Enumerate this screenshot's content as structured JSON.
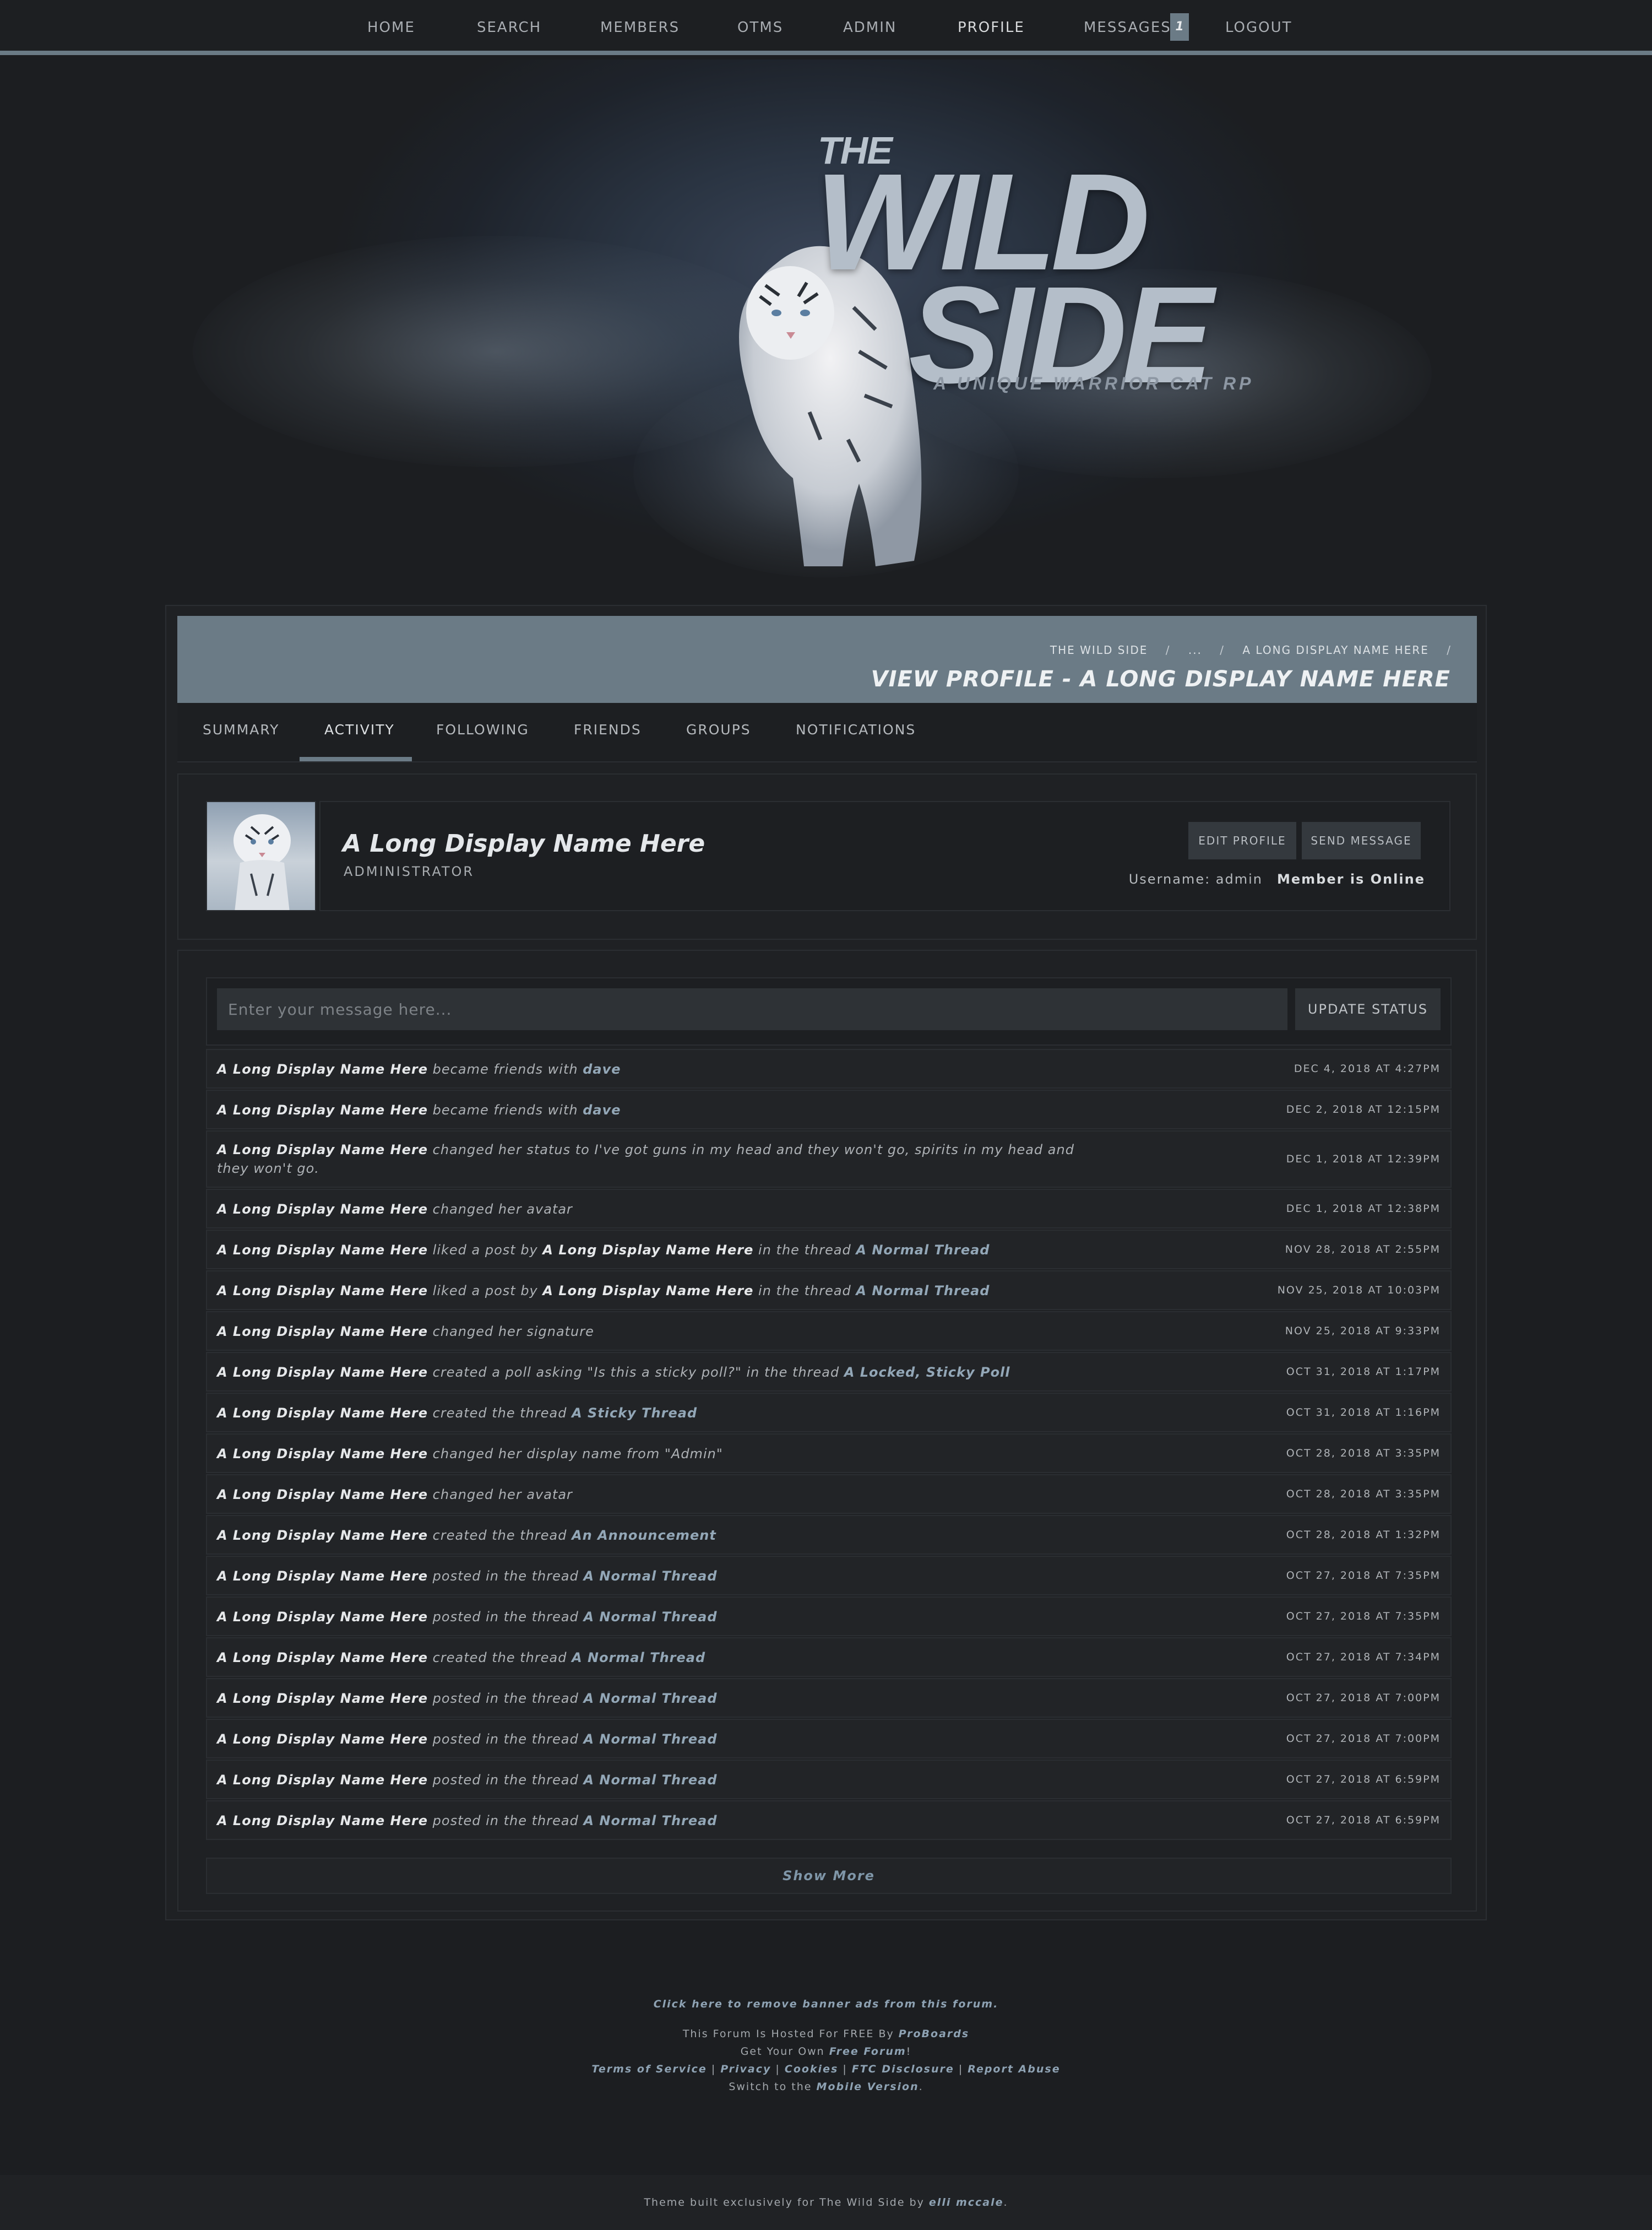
{
  "nav": {
    "items": [
      "HOME",
      "SEARCH",
      "MEMBERS",
      "OTMS",
      "ADMIN",
      "PROFILE",
      "MESSAGES",
      "LOGOUT"
    ],
    "messages_count": "1",
    "active": "PROFILE"
  },
  "banner": {
    "the": "THE",
    "wild": "WILD",
    "side": "SIDE",
    "tagline": "A UNIQUE WARRIOR CAT RP"
  },
  "breadcrumb": [
    "THE WILD SIDE",
    "/",
    "...",
    "/",
    "A LONG DISPLAY NAME HERE",
    "/"
  ],
  "page_title": "VIEW PROFILE - A LONG DISPLAY NAME HERE",
  "tabs": [
    "SUMMARY",
    "ACTIVITY",
    "FOLLOWING",
    "FRIENDS",
    "GROUPS",
    "NOTIFICATIONS"
  ],
  "active_tab": "ACTIVITY",
  "profile": {
    "display_name": "A Long Display Name Here",
    "role": "ADMINISTRATOR",
    "edit_button": "EDIT PROFILE",
    "message_button": "SEND MESSAGE",
    "username": "Username: admin",
    "online": "Member is Online"
  },
  "status": {
    "placeholder": "Enter your message here...",
    "button": "UPDATE STATUS"
  },
  "feed": [
    {
      "actor": "A Long Display Name Here",
      "action": " became friends with ",
      "target": "dave",
      "date": "DEC 4, 2018 AT 4:27PM"
    },
    {
      "actor": "A Long Display Name Here",
      "action": " became friends with ",
      "target": "dave",
      "date": "DEC 2, 2018 AT 12:15PM"
    },
    {
      "actor": "A Long Display Name Here",
      "action": " changed her status to I've got guns in my head and they won't go, spirits in my head and they won't go.",
      "target": "",
      "date": "DEC 1, 2018 AT 12:39PM"
    },
    {
      "actor": "A Long Display Name Here",
      "action": " changed her avatar",
      "target": "",
      "date": "DEC 1, 2018 AT 12:38PM"
    },
    {
      "actor": "A Long Display Name Here",
      "action": " liked a post by ",
      "actor2": "A Long Display Name Here",
      "action2": " in the thread ",
      "target": "A Normal Thread",
      "date": "NOV 28, 2018 AT 2:55PM"
    },
    {
      "actor": "A Long Display Name Here",
      "action": " liked a post by ",
      "actor2": "A Long Display Name Here",
      "action2": " in the thread ",
      "target": "A Normal Thread",
      "date": "NOV 25, 2018 AT 10:03PM"
    },
    {
      "actor": "A Long Display Name Here",
      "action": " changed her signature",
      "target": "",
      "date": "NOV 25, 2018 AT 9:33PM"
    },
    {
      "actor": "A Long Display Name Here",
      "action": " created a poll asking \"Is this a sticky poll?\" in the thread ",
      "target": "A Locked, Sticky Poll",
      "date": "OCT 31, 2018 AT 1:17PM"
    },
    {
      "actor": "A Long Display Name Here",
      "action": " created the thread ",
      "target": "A Sticky Thread",
      "date": "OCT 31, 2018 AT 1:16PM"
    },
    {
      "actor": "A Long Display Name Here",
      "action": " changed her display name from \"Admin\"",
      "target": "",
      "date": "OCT 28, 2018 AT 3:35PM"
    },
    {
      "actor": "A Long Display Name Here",
      "action": " changed her avatar",
      "target": "",
      "date": "OCT 28, 2018 AT 3:35PM"
    },
    {
      "actor": "A Long Display Name Here",
      "action": " created the thread ",
      "target": "An Announcement",
      "date": "OCT 28, 2018 AT 1:32PM"
    },
    {
      "actor": "A Long Display Name Here",
      "action": " posted in the thread ",
      "target": "A Normal Thread",
      "date": "OCT 27, 2018 AT 7:35PM"
    },
    {
      "actor": "A Long Display Name Here",
      "action": " posted in the thread ",
      "target": "A Normal Thread",
      "date": "OCT 27, 2018 AT 7:35PM"
    },
    {
      "actor": "A Long Display Name Here",
      "action": " created the thread ",
      "target": "A Normal Thread",
      "date": "OCT 27, 2018 AT 7:34PM"
    },
    {
      "actor": "A Long Display Name Here",
      "action": " posted in the thread ",
      "target": "A Normal Thread",
      "date": "OCT 27, 2018 AT 7:00PM"
    },
    {
      "actor": "A Long Display Name Here",
      "action": " posted in the thread ",
      "target": "A Normal Thread",
      "date": "OCT 27, 2018 AT 7:00PM"
    },
    {
      "actor": "A Long Display Name Here",
      "action": " posted in the thread ",
      "target": "A Normal Thread",
      "date": "OCT 27, 2018 AT 6:59PM"
    },
    {
      "actor": "A Long Display Name Here",
      "action": " posted in the thread ",
      "target": "A Normal Thread",
      "date": "OCT 27, 2018 AT 6:59PM"
    }
  ],
  "show_more": "Show More",
  "footer": {
    "remove_ads": "Click here to remove banner ads from this forum.",
    "hosted_prefix": "This Forum Is Hosted For FREE By ",
    "hosted_link": "ProBoards",
    "own_prefix": "Get Your Own ",
    "own_link": "Free Forum",
    "own_suffix": "!",
    "links": [
      "Terms of Service",
      "Privacy",
      "Cookies",
      "FTC Disclosure",
      "Report Abuse"
    ],
    "link_sep": " | ",
    "mobile_prefix": "Switch to the ",
    "mobile_link": "Mobile Version",
    "mobile_suffix": ".",
    "credit_prefix": "Theme built exclusively for The Wild Side by ",
    "credit_link": "elli mccale",
    "credit_suffix": "."
  },
  "colors": {
    "accent": "#6b7b86",
    "background": "#1c1e21",
    "link": "#93a7b7"
  }
}
